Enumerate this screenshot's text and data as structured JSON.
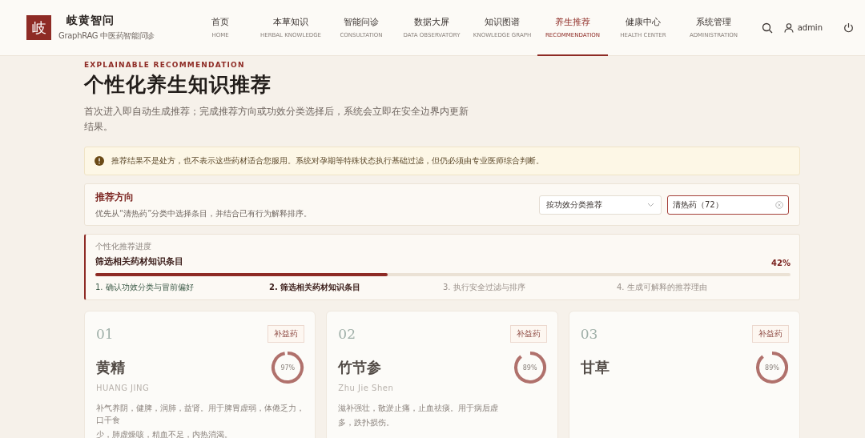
{
  "header": {
    "logo": "岐",
    "title": "岐黄智问",
    "subtitle": "GraphRAG 中医药智能问诊",
    "nav": [
      {
        "label": "首页",
        "sub": "HOME",
        "selected": false
      },
      {
        "label": "本草知识",
        "sub": "HERBAL KNOWLEDGE",
        "selected": false
      },
      {
        "label": "智能问诊",
        "sub": "CONSULTATION",
        "selected": false
      },
      {
        "label": "数据大屏",
        "sub": "DATA OBSERVATORY",
        "selected": false
      },
      {
        "label": "知识图谱",
        "sub": "KNOWLEDGE GRAPH",
        "selected": false
      },
      {
        "label": "养生推荐",
        "sub": "RECOMMENDATION",
        "selected": true
      },
      {
        "label": "健康中心",
        "sub": "HEALTH CENTER",
        "selected": false
      },
      {
        "label": "系统管理",
        "sub": "ADMINISTRATION",
        "selected": false
      }
    ],
    "user": "admin"
  },
  "intro": {
    "eyebrow": "EXPLAINABLE RECOMMENDATION",
    "title": "个性化养生知识推荐",
    "description": "首次进入即自动生成推荐；完成推荐方向或功效分类选择后，系统会立即在安全边界内更新结果。"
  },
  "notice": "推荐结果不是处方，也不表示这些药材适合您服用。系统对孕期等特殊状态执行基础过滤，但仍必须由专业医师综合判断。",
  "direction": {
    "title": "推荐方向",
    "hint": "优先从“清热药”分类中选择条目，并结合已有行为解释排序。",
    "mode_select": "按功效分类推荐",
    "category_field": "清热药（72）"
  },
  "progress": {
    "label": "个性化推荐进度",
    "current": "筛选相关药材知识条目",
    "percent": "42%",
    "level": 0.42,
    "steps": [
      {
        "label": "1. 确认功效分类与冒前偏好",
        "completed": true,
        "selected": false
      },
      {
        "label": "2. 筛选相关药材知识条目",
        "completed": false,
        "selected": true
      },
      {
        "label": "3. 执行安全过滤与排序",
        "completed": false,
        "selected": false
      },
      {
        "label": "4. 生成可解释的推荐理由",
        "completed": false,
        "selected": false
      }
    ]
  },
  "cards": [
    {
      "index": "01",
      "tag": "补益药",
      "name": "黄精",
      "pinyin": "HUANG JING",
      "score": "97%",
      "level": 0.97,
      "description_lines": [
        "补气养阴，健脾，润肺，益肾。用于脾胃虚弱，体倦乏力，口干食",
        "少，肺虚燥咳，精血不足，内热消渴。"
      ]
    },
    {
      "index": "02",
      "tag": "补益药",
      "name": "竹节参",
      "pinyin": "Zhu Jie Shen",
      "score": "89%",
      "level": 0.89,
      "description_lines": [
        "滋补强壮，散淤止痛，止血祛痰。用于病后虚",
        "多，跌扑损伤。"
      ]
    },
    {
      "index": "03",
      "tag": "补益药",
      "name": "甘草",
      "score": "89%",
      "level": 0.89
    }
  ]
}
